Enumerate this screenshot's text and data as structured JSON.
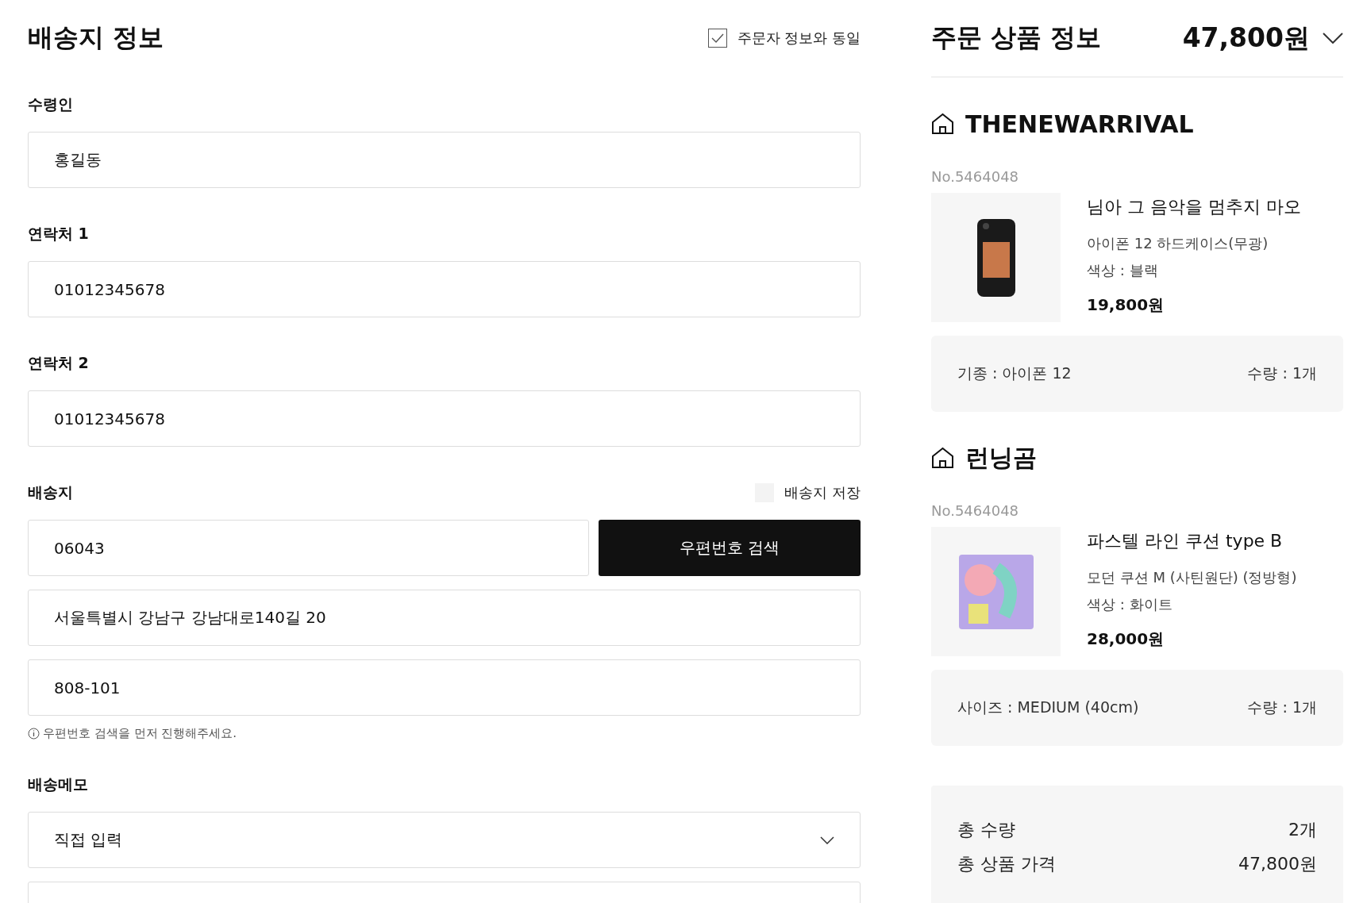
{
  "shipping": {
    "title": "배송지 정보",
    "same_as_orderer": {
      "label": "주문자 정보와 동일",
      "checked": true
    },
    "fields": [
      {
        "label": "수령인",
        "value": "홍길동"
      },
      {
        "label": "연락처 1",
        "value": "01012345678"
      },
      {
        "label": "연락처 2",
        "value": "01012345678"
      }
    ],
    "address": {
      "label": "배송지",
      "save": {
        "label": "배송지 저장",
        "checked": false
      },
      "zipcode": "06043",
      "search_button": "우편번호 검색",
      "address1": "서울특별시 강남구 강남대로140길 20",
      "address2": "808-101",
      "notice": "우편번호 검색을 먼저 진행해주세요."
    },
    "memo": {
      "label": "배송메모",
      "selected_option": "직접 입력"
    }
  },
  "order": {
    "title": "주문 상품 정보",
    "total": "47,800원",
    "expanded": false,
    "shops": [
      {
        "name": "THENEWARRIVAL",
        "items": [
          {
            "number": "No.5464048",
            "kind": "phone_case",
            "name": "님아 그 음악을 멈추지 마오",
            "option": "아이폰 12 하드케이스(무광)",
            "color_option": "색상 : 블랙",
            "price": "19,800원",
            "detail": "기종 : 아이폰 12",
            "quantity": "수량 : 1개"
          }
        ]
      },
      {
        "name": "런닝곰",
        "items": [
          {
            "number": "No.5464048",
            "kind": "cushion",
            "name": "파스텔 라인 쿠션 type B",
            "option": "모던 쿠션 M (사틴원단) (정방형)",
            "color_option": "색상 : 화이트",
            "price": "28,000원",
            "detail": "사이즈 : MEDIUM (40cm)",
            "quantity": "수량 : 1개"
          }
        ]
      }
    ],
    "summary": [
      {
        "label": "총 수량",
        "value": "2개"
      },
      {
        "label": "총 상품 가격",
        "value": "47,800원"
      }
    ]
  }
}
